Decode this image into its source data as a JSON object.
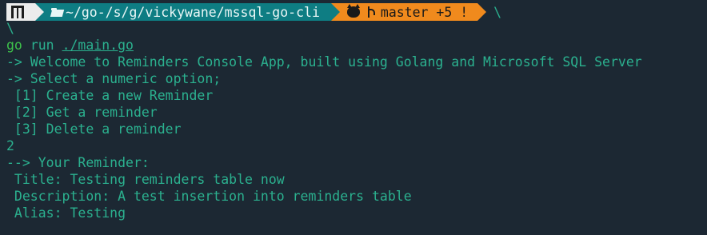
{
  "prompt": {
    "os_icon": "manjaro-logo-icon",
    "folder_icon": "folder-open-icon",
    "path": "~/go-/s/g/vickywane/mssql-go-cli",
    "github_icon": "github-icon",
    "branch_icon": "git-branch-icon",
    "branch": "master +5 !",
    "trailing": "\\"
  },
  "continuation": "\\",
  "command": {
    "program": "go",
    "subcommand": "run",
    "file": "./main.go"
  },
  "output": [
    "-> Welcome to Reminders Console App, built using Golang and Microsoft SQL Server",
    "-> Select a numeric option;",
    " [1] Create a new Reminder",
    " [2] Get a reminder",
    " [3] Delete a reminder",
    "2",
    "--> Your Reminder:",
    " Title: Testing reminders table now",
    " Description: A test insertion into reminders table",
    " Alias: Testing"
  ],
  "colors": {
    "background": "#1c2833",
    "text": "#2bb18f",
    "command": "#3ec24b",
    "os_segment": "#ececec",
    "path_segment": "#0e7d83",
    "git_segment": "#f08a1d"
  }
}
